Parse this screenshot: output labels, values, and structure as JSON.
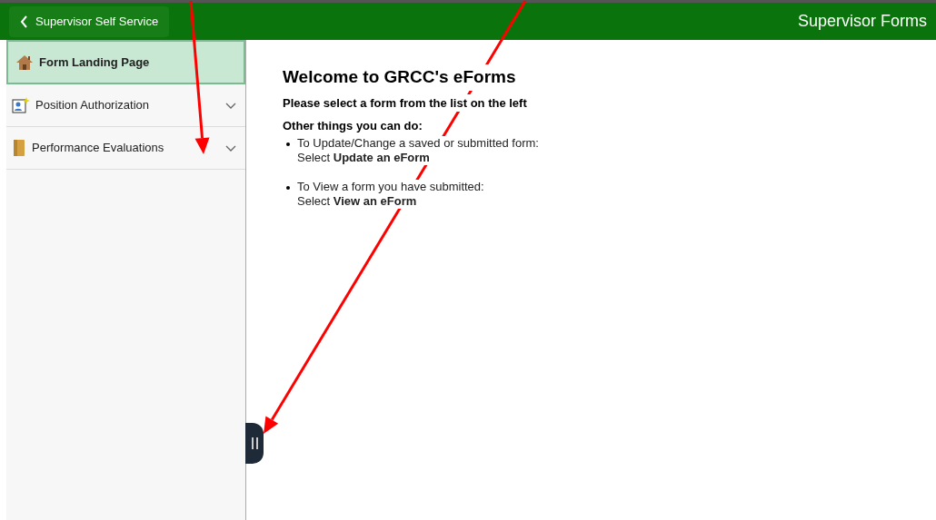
{
  "header": {
    "back_button": "Supervisor Self Service",
    "title": "Supervisor Forms"
  },
  "sidebar": {
    "items": [
      {
        "label": "Form Landing Page",
        "kind": "home",
        "selected": true
      },
      {
        "label": "Position Authorization",
        "kind": "person",
        "selected": false,
        "expanded": false
      },
      {
        "label": "Performance Evaluations",
        "kind": "folder",
        "selected": false,
        "expanded": false
      }
    ]
  },
  "content": {
    "heading": "Welcome to GRCC's eForms",
    "subheading": "Please select a form from the list on the left",
    "list_title": "Other things you can do:",
    "items": [
      {
        "line1": "To Update/Change a saved or submitted form:",
        "line2": "Select **Update an eForm**"
      },
      {
        "line1": "To View a form you have submitted:",
        "line2": "Select **View an eForm**"
      }
    ]
  },
  "annotation_arrows": [
    {
      "kind": "arrow"
    },
    {
      "kind": "arrow"
    }
  ]
}
